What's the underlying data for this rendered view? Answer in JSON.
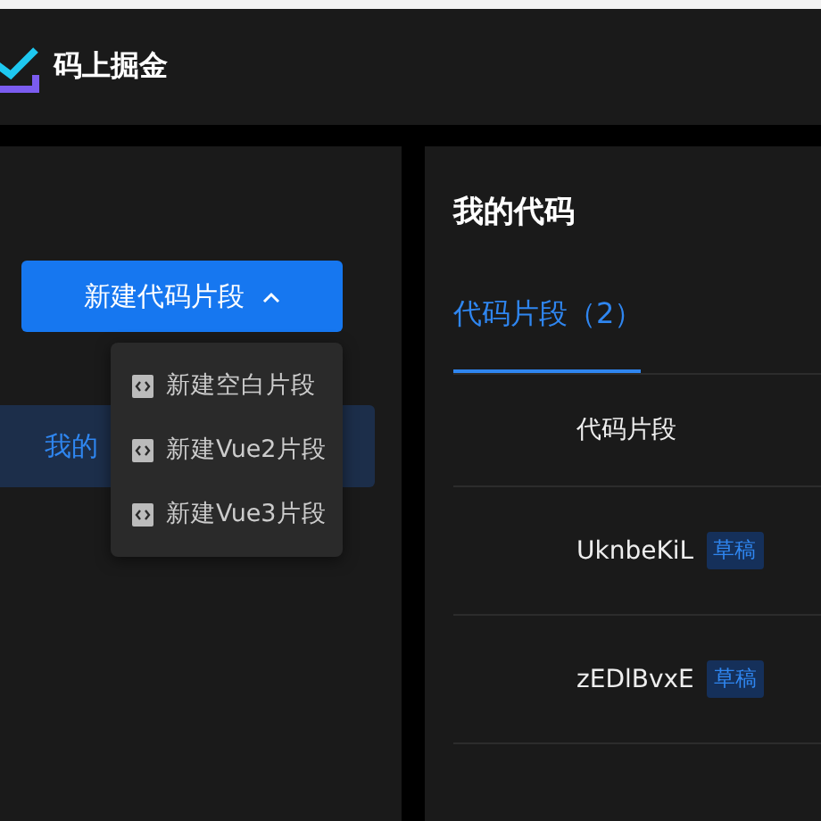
{
  "header": {
    "brand": "码上掘金"
  },
  "sidebar": {
    "new_button": {
      "label": "新建代码片段",
      "expanded": true
    },
    "items": [
      {
        "label": "我的",
        "selected": true
      }
    ],
    "dropdown": [
      {
        "label": "新建空白片段"
      },
      {
        "label": "新建Vue2片段"
      },
      {
        "label": "新建Vue3片段"
      }
    ]
  },
  "main": {
    "title": "我的代码",
    "tabs": [
      {
        "label": "代码片段（2）",
        "selected": true
      }
    ],
    "table": {
      "columns": [
        "代码片段"
      ],
      "rows": [
        {
          "name": "UknbeKiL",
          "tag": "草稿"
        },
        {
          "name": "zEDlBvxE",
          "tag": "草稿"
        }
      ]
    }
  }
}
